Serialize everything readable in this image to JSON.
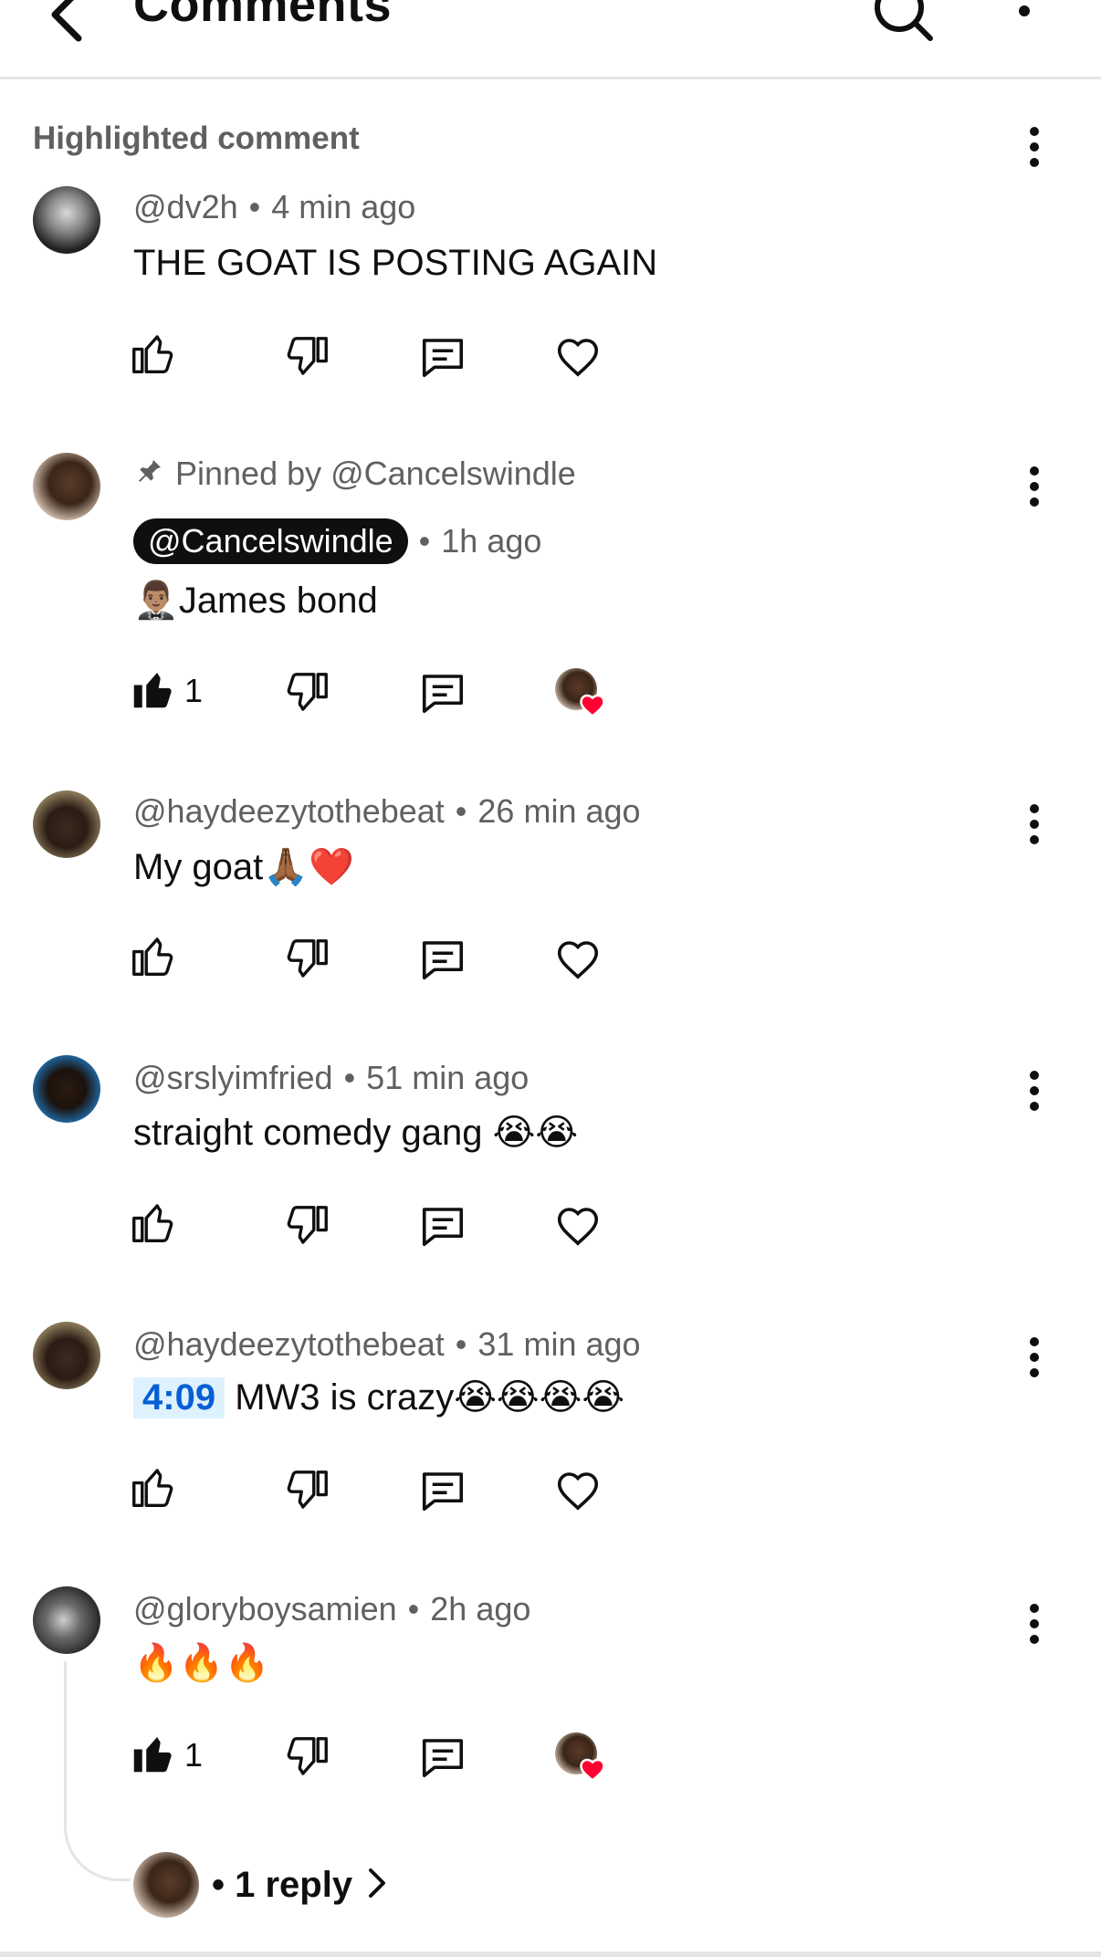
{
  "header": {
    "title": "Comments",
    "back_icon": "back-arrow-icon",
    "search_icon": "search-icon",
    "more_icon": "more-vert-icon"
  },
  "section_label": "Highlighted comment",
  "colors": {
    "text_primary": "#0f0f0f",
    "text_secondary": "#606060",
    "divider": "#e5e5e5",
    "owner_chip_bg": "#0f0f0f",
    "timestamp_link": "#065fd4",
    "timestamp_bg": "#def1ff",
    "heart_red": "#ff0033"
  },
  "comments": [
    {
      "author": "@dv2h",
      "time": "4 min ago",
      "text": "THE GOAT IS POSTING AGAIN",
      "likes": "",
      "hearted": false
    },
    {
      "pinned_label": "Pinned by @Cancelswindle",
      "author": "@Cancelswindle",
      "time": "1h ago",
      "text_emoji": "🤵🏽‍♂️",
      "text": "James bond",
      "likes": "1",
      "hearted": true
    },
    {
      "author": "@haydeezytothebeat",
      "time": "26 min ago",
      "text": "My goat",
      "text_emoji": "🙏🏾❤️",
      "likes": "",
      "hearted": false
    },
    {
      "author": "@srslyimfried",
      "time": "51 min ago",
      "text": "straight comedy gang",
      "text_emoji": "😭😭",
      "likes": "",
      "hearted": false
    },
    {
      "author": "@haydeezytothebeat",
      "time": "31 min ago",
      "timestamp_link": "4:09",
      "text": "MW3 is crazy",
      "text_emoji": "😭😭😭😭",
      "likes": "",
      "hearted": false
    },
    {
      "author": "@gloryboysamien",
      "time": "2h ago",
      "text_emoji": "🔥🔥🔥",
      "likes": "1",
      "hearted": true,
      "replies_label": "• 1 reply"
    }
  ]
}
